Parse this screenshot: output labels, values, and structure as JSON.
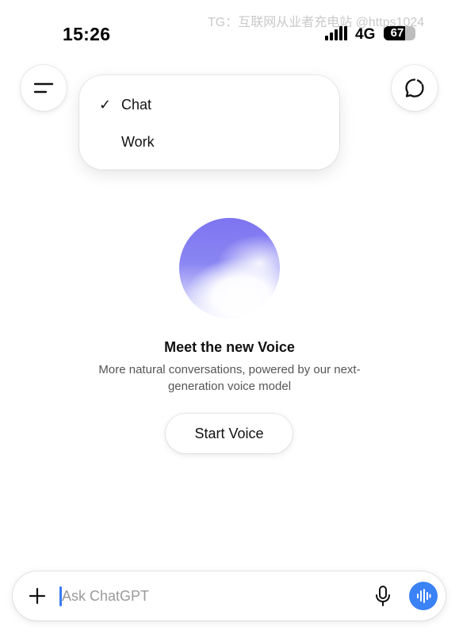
{
  "status_bar": {
    "time": "15:26",
    "watermark": "TG：互联网从业者充电站 @https1024",
    "network": "4G",
    "battery": "67",
    "battery_level": 0.67
  },
  "header": {
    "menu_icon": "menu-icon",
    "new_chat_icon": "new-chat-icon"
  },
  "mode_dropdown": {
    "items": [
      {
        "label": "Chat",
        "selected": true,
        "check": "✓"
      },
      {
        "label": "Work",
        "selected": false,
        "check": ""
      }
    ]
  },
  "promo": {
    "title": "Meet the new Voice",
    "subtitle": "More natural conversations, powered by our next-generation voice model",
    "button_label": "Start Voice",
    "orb_colors": [
      "#7d74f0",
      "#c9c8fa",
      "#ffffff"
    ]
  },
  "composer": {
    "placeholder": "Ask ChatGPT",
    "value": "",
    "plus_icon": "plus-icon",
    "mic_icon": "microphone-icon",
    "voice_icon": "voice-mode-icon",
    "accent_color": "#3b82f6"
  }
}
